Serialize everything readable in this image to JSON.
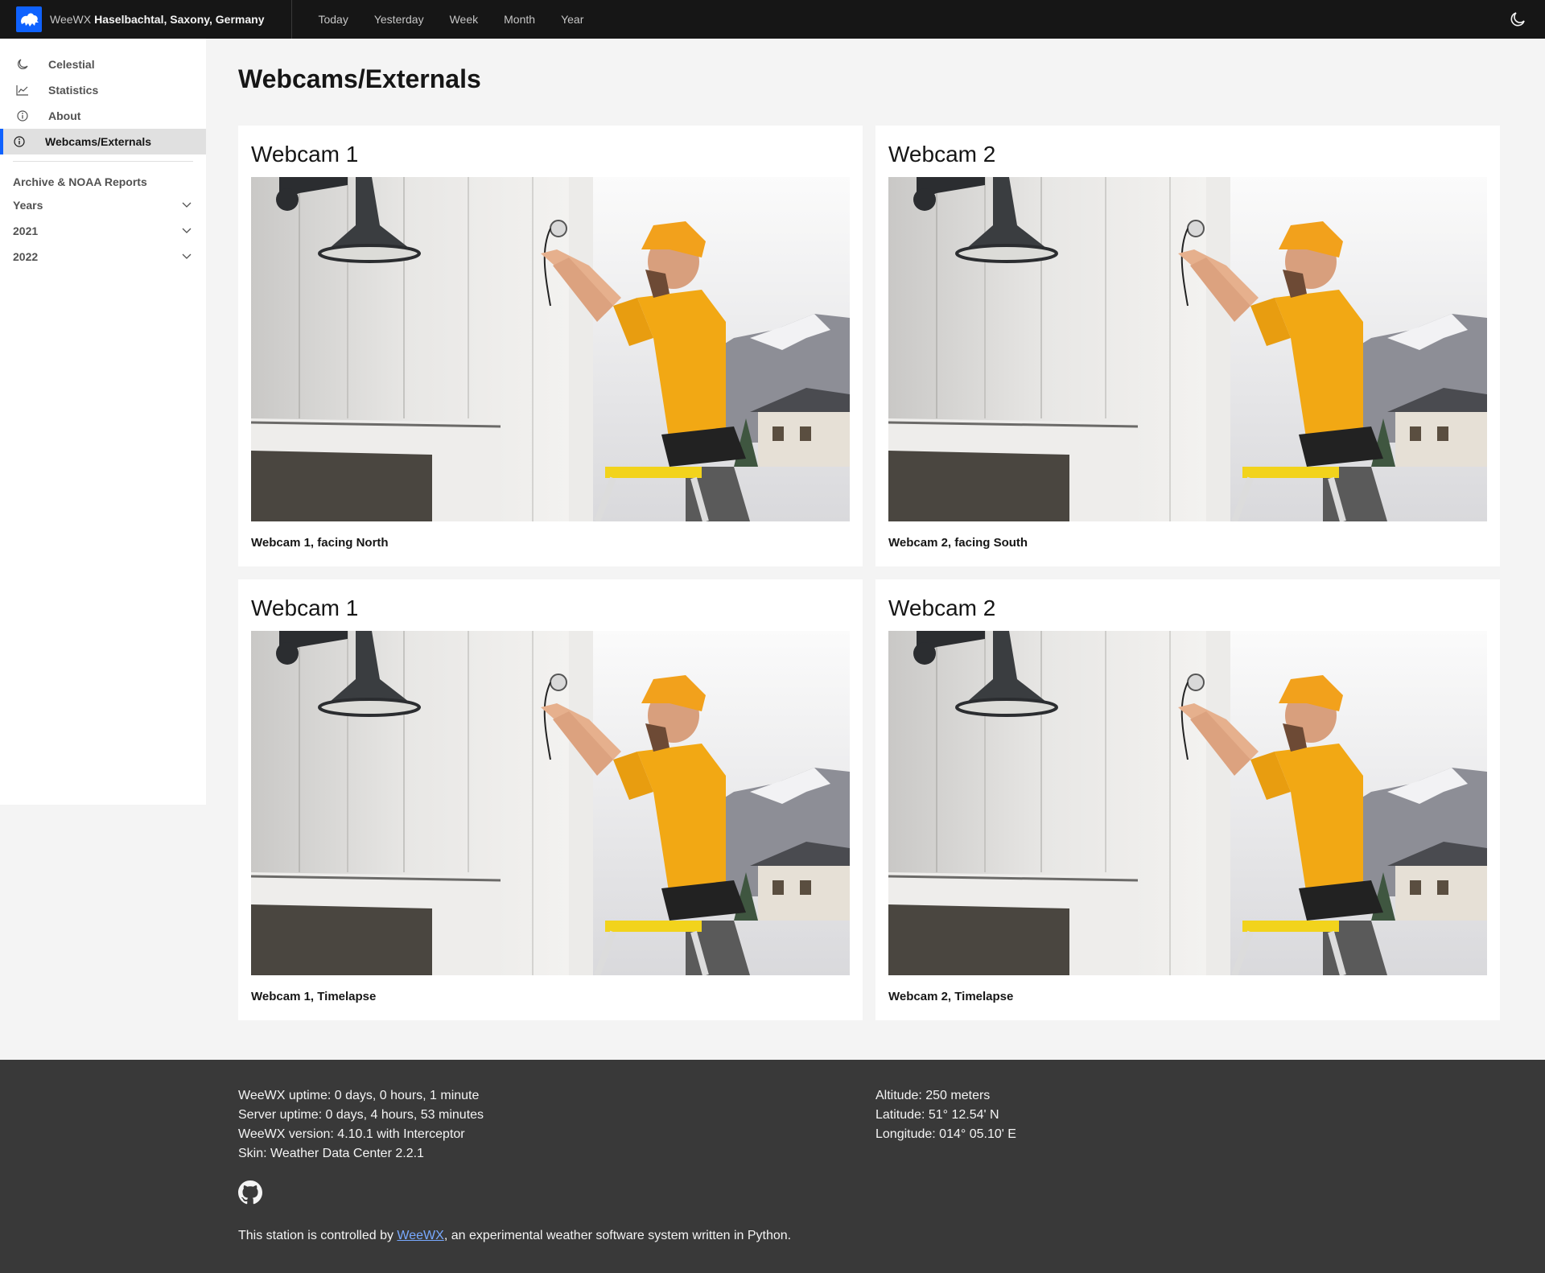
{
  "header": {
    "app_name": "WeeWX",
    "station": "Haselbachtal, Saxony, Germany",
    "nav": [
      "Today",
      "Yesterday",
      "Week",
      "Month",
      "Year"
    ]
  },
  "sidebar": {
    "items": [
      {
        "label": "Celestial",
        "icon": "moon-icon"
      },
      {
        "label": "Statistics",
        "icon": "chart-line-icon"
      },
      {
        "label": "About",
        "icon": "info-icon"
      },
      {
        "label": "Webcams/Externals",
        "icon": "info-icon",
        "active": true
      }
    ],
    "archive_heading": "Archive & NOAA Reports",
    "toggles": [
      "Years",
      "2021",
      "2022"
    ]
  },
  "main": {
    "title": "Webcams/Externals",
    "cards": [
      {
        "title": "Webcam 1",
        "caption": "Webcam 1, facing North"
      },
      {
        "title": "Webcam 2",
        "caption": "Webcam 2, facing South"
      },
      {
        "title": "Webcam 1",
        "caption": "Webcam 1, Timelapse"
      },
      {
        "title": "Webcam 2",
        "caption": "Webcam 2, Timelapse"
      }
    ]
  },
  "footer": {
    "left": [
      "WeeWX uptime: 0 days, 0 hours, 1 minute",
      "Server uptime: 0 days, 4 hours, 53 minutes",
      "WeeWX version: 4.10.1 with Interceptor",
      "Skin: Weather Data Center 2.2.1"
    ],
    "right": [
      "Altitude: 250 meters",
      "Latitude: 51° 12.54' N",
      "Longitude: 014° 05.10' E"
    ],
    "controlled_prefix": "This station is controlled by ",
    "controlled_link": "WeeWX",
    "controlled_suffix": ", an experimental weather software system written in Python."
  },
  "colors": {
    "header_bg": "#161616",
    "accent": "#0f62fe",
    "footer_bg": "#393939",
    "link": "#78a9ff"
  }
}
